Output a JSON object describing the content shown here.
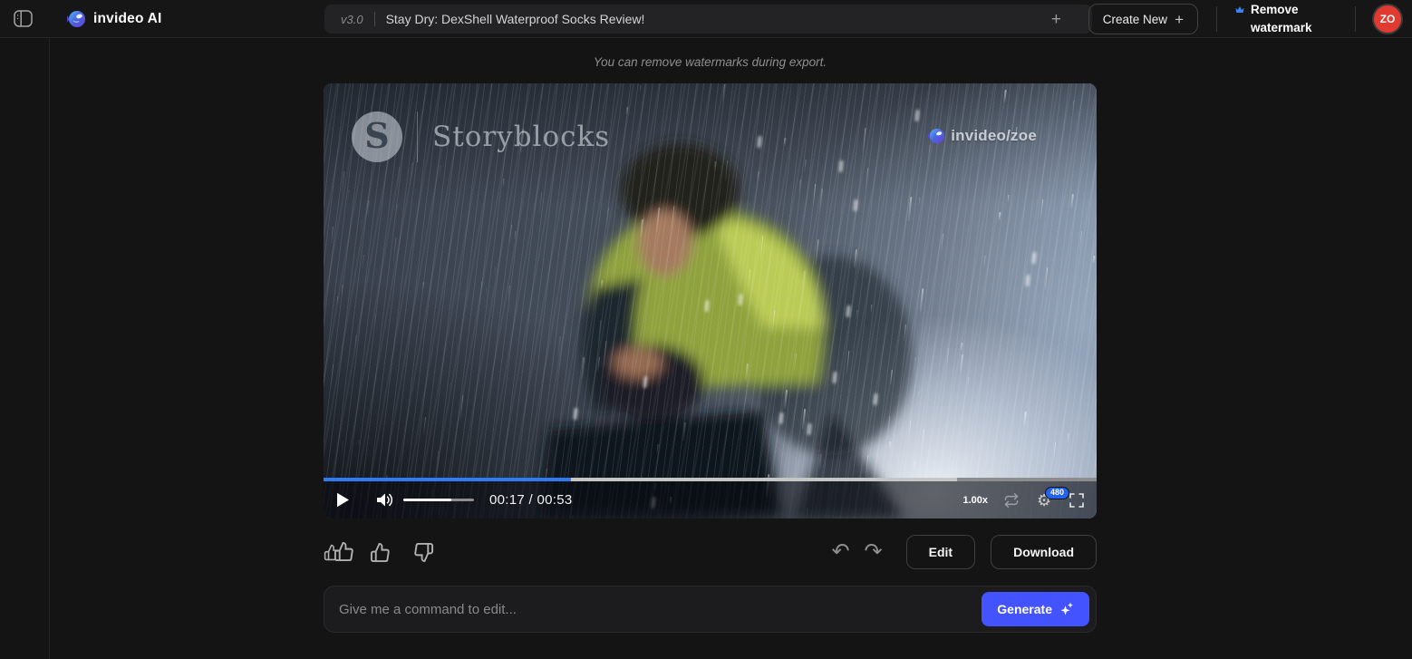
{
  "header": {
    "brand": "invideo AI",
    "version": "v3.0",
    "project_title": "Stay Dry: DexShell Waterproof Socks Review!",
    "add_tab_glyph": "+",
    "create_new_label": "Create New",
    "create_new_plus_glyph": "+",
    "remove_watermark_label": "Remove watermark",
    "avatar_initials": "ZO"
  },
  "notice": "You can remove watermarks during export.",
  "player": {
    "storyblocks_glyph": "S",
    "storyblocks_label": "Storyblocks",
    "invideo_watermark": "invideo/zoe",
    "time_display": "00:17 / 00:53",
    "speed": "1.00x",
    "quality_badge": "480",
    "played_pct": 32,
    "buffered_pct": 82,
    "volume_pct": 68
  },
  "actions": {
    "edit_label": "Edit",
    "download_label": "Download"
  },
  "command_bar": {
    "placeholder": "Give me a command to edit...",
    "generate_label": "Generate"
  },
  "icons": {
    "undo_glyph": "↶",
    "redo_glyph": "↷",
    "gear_glyph": "⚙"
  },
  "colors": {
    "progress_accent": "#2e7bf3",
    "generate_button": "#4353ff",
    "avatar_bg": "#e03a31",
    "crown_blue": "#3b82f6",
    "quality_badge_bg": "#2563eb",
    "background": "#141414"
  }
}
